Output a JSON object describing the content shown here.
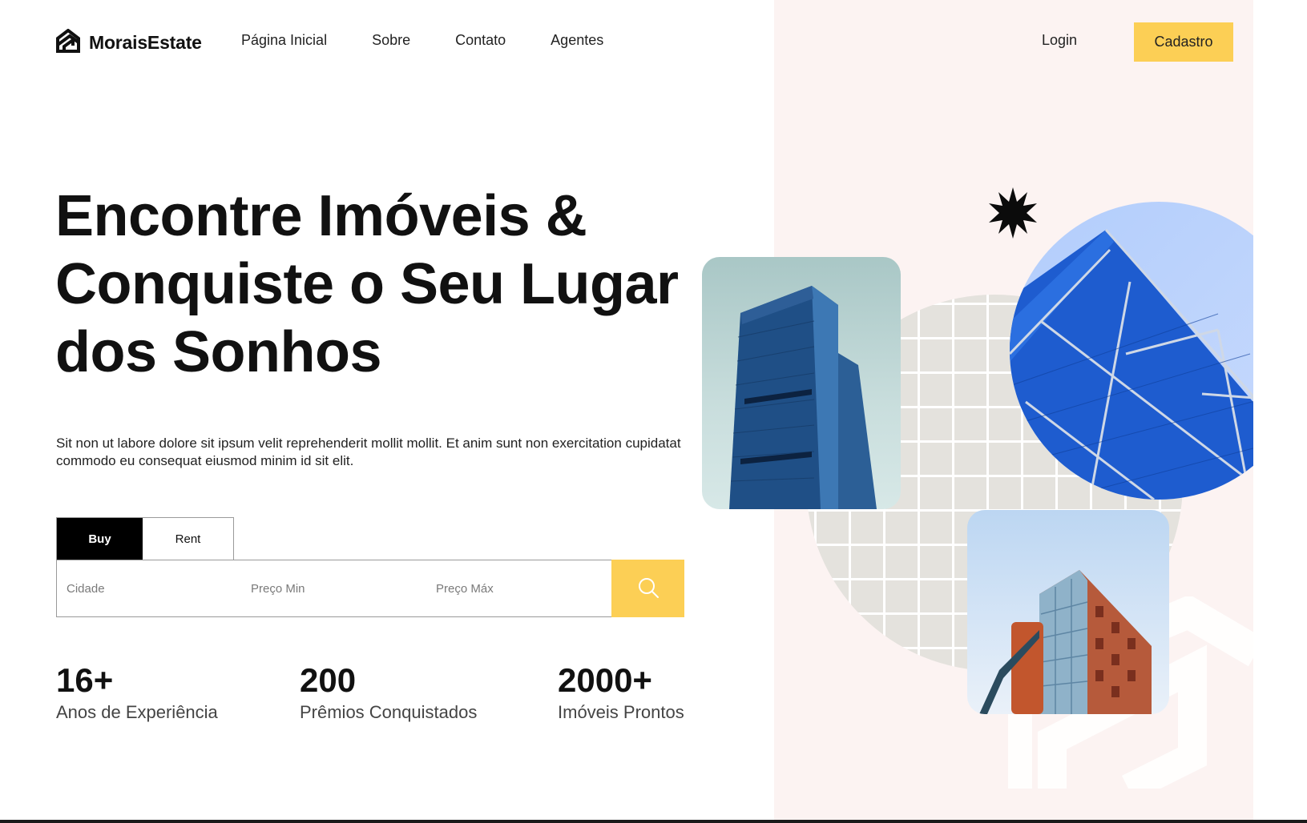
{
  "brand": {
    "name": "MoraisEstate",
    "logo_icon": "house-outline-logo-icon"
  },
  "nav": {
    "items": [
      {
        "label": "Página Inicial"
      },
      {
        "label": "Sobre"
      },
      {
        "label": "Contato"
      },
      {
        "label": "Agentes"
      }
    ]
  },
  "auth": {
    "login_label": "Login",
    "signup_label": "Cadastro"
  },
  "hero": {
    "title_lines": [
      "Encontre Imóveis &",
      "Conquiste o Seu Lugar",
      "dos Sonhos"
    ],
    "description": "Sit non ut labore dolore sit ipsum velit reprehenderit mollit mollit. Et anim sunt non exercitation cupidatat commodo eu consequat eiusmod minim id sit elit."
  },
  "search": {
    "tabs": [
      {
        "label": "Buy",
        "active": true
      },
      {
        "label": "Rent",
        "active": false
      }
    ],
    "fields": [
      {
        "placeholder": "Cidade",
        "value": ""
      },
      {
        "placeholder": "Preço Min",
        "value": ""
      },
      {
        "placeholder": "Preço Máx",
        "value": ""
      }
    ],
    "button_icon": "search-icon"
  },
  "stats": [
    {
      "value": "16+",
      "label": "Anos de Experiência"
    },
    {
      "value": "200",
      "label": "Prêmios Conquistados"
    },
    {
      "value": "2000+",
      "label": "Imóveis Prontos"
    }
  ],
  "colors": {
    "accent": "#fccf55",
    "panel_background": "#fcf3f2",
    "text_primary": "#111111"
  },
  "illustrations": [
    "starburst-icon",
    "building-photo",
    "glass-building-photo",
    "brick-building-photo",
    "grid-circle-pattern",
    "house-outline-icon"
  ]
}
